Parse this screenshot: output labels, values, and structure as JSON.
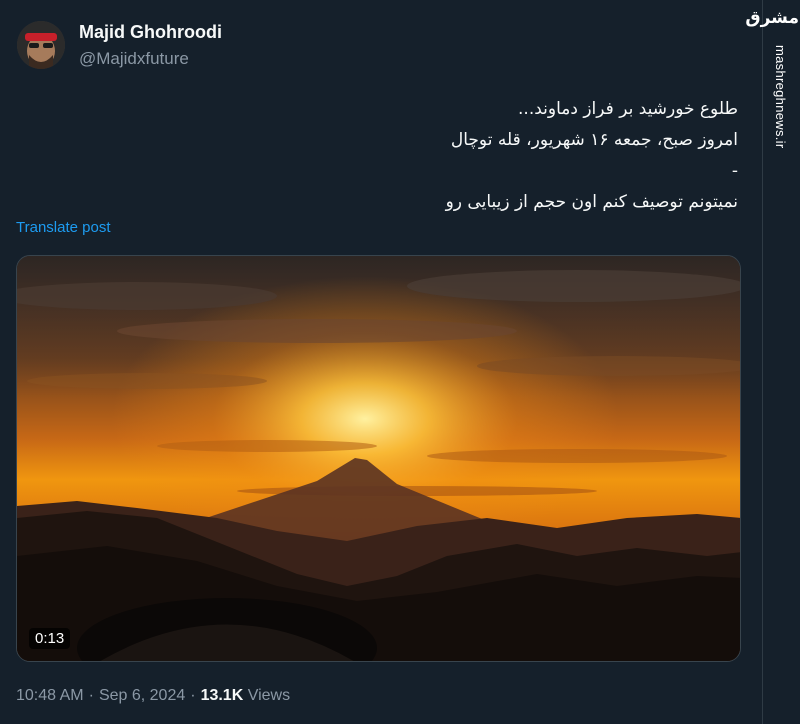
{
  "author": {
    "display_name": "Majid Ghohroodi",
    "handle": "@Majidxfuture"
  },
  "tweet": {
    "lines": [
      "طلوع خورشید بر فراز دماوند...",
      "امروز صبح، جمعه ۱۶ شهریور، قله توچال",
      "-",
      "نمیتونم توصیف کنم اون حجم از زیبایی رو"
    ],
    "translate_label": "Translate post"
  },
  "media": {
    "duration": "0:13"
  },
  "meta": {
    "time": "10:48 AM",
    "date": "Sep 6, 2024",
    "separator": "·",
    "views_count": "13.1K",
    "views_label": "Views"
  },
  "watermark": {
    "logo_text": "مشرق",
    "url": "mashreghnews.ir"
  },
  "colors": {
    "background": "#15202b",
    "text": "#f7f9f9",
    "muted": "#8b98a5",
    "link": "#1d9bf0"
  }
}
